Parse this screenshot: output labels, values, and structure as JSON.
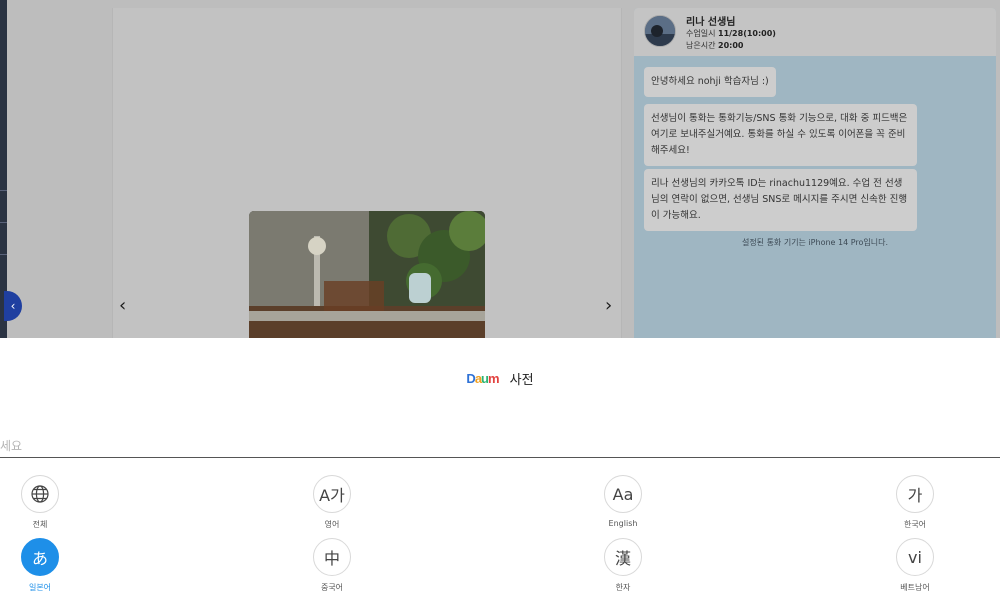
{
  "background": {
    "teacher": {
      "name": "리나 선생님",
      "lesson_label": "수업일시",
      "lesson_value": "11/28(10:00)",
      "remaining_label": "남은시간",
      "remaining_value": "20:00"
    },
    "messages": [
      "안녕하세요 nohji 학습자님 :)",
      "선생님이 통화는 통화기능/SNS 통화 기능으로, 대화 중 피드백은 여기로 보내주실거예요. 통화를 하실 수 있도록 이어폰을 꼭 준비해주세요!",
      "리나 선생님의 카카오톡 ID는 rinachu1129예요. 수업 전 선생님의 연락이 없으면, 선생님 SNS로 메시지를 주시면 신속한 진행이 가능해요."
    ],
    "notice": "설정된 통화 기기는 iPhone 14 Pro입니다.",
    "prev_arrow": "‹",
    "next_arrow": "›",
    "collapse_icon": "‹"
  },
  "dictionary": {
    "logo": [
      "D",
      "a",
      "u",
      "m"
    ],
    "title": "사전",
    "search_placeholder": "세요",
    "languages": [
      {
        "glyph": "globe",
        "label": "전체",
        "active": false
      },
      {
        "glyph": "A가",
        "label": "영어",
        "active": false
      },
      {
        "glyph": "Aa",
        "label": "English",
        "active": false
      },
      {
        "glyph": "가",
        "label": "한국어",
        "active": false
      },
      {
        "glyph": "あ",
        "label": "일본어",
        "active": true
      },
      {
        "glyph": "中",
        "label": "중국어",
        "active": false
      },
      {
        "glyph": "漢",
        "label": "한자",
        "active": false
      },
      {
        "glyph": "vi",
        "label": "베트남어",
        "active": false
      }
    ]
  },
  "colors": {
    "accent": "#1e8fe8",
    "chat_bg": "#9fb6c2",
    "overlay": "#bdbdbd"
  }
}
